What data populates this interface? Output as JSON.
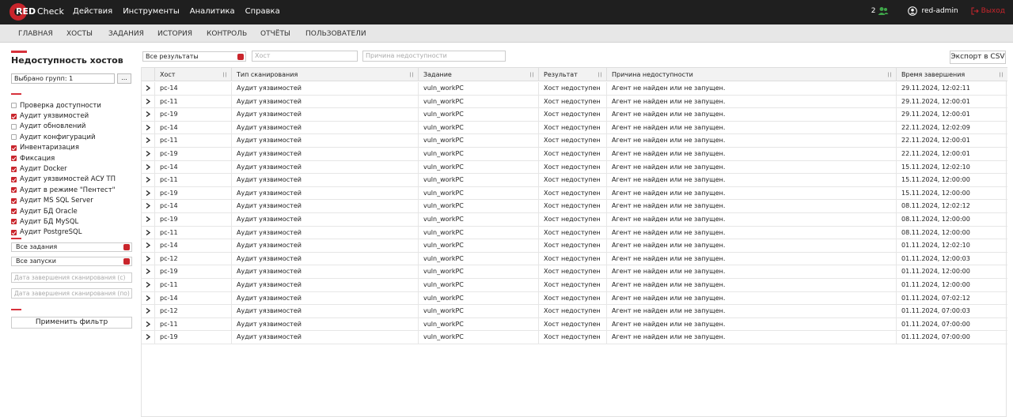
{
  "app": {
    "logo_red": "RED",
    "logo_check": "Check",
    "nav": [
      "Действия",
      "Инструменты",
      "Аналитика",
      "Справка"
    ],
    "notifications_count": "2",
    "user": "red-admin",
    "logout": "Выход"
  },
  "subnav": [
    "ГЛАВНАЯ",
    "ХОСТЫ",
    "ЗАДАНИЯ",
    "ИСТОРИЯ",
    "КОНТРОЛЬ",
    "ОТЧЁТЫ",
    "ПОЛЬЗОВАТЕЛИ"
  ],
  "sidebar": {
    "title": "Недоступность хостов",
    "group_select": "Выбрано групп: 1",
    "group_more": "...",
    "checkboxes": [
      {
        "label": "Проверка доступности",
        "checked": false
      },
      {
        "label": "Аудит уязвимостей",
        "checked": true
      },
      {
        "label": "Аудит обновлений",
        "checked": false
      },
      {
        "label": "Аудит конфигураций",
        "checked": false
      },
      {
        "label": "Инвентаризация",
        "checked": true
      },
      {
        "label": "Фиксация",
        "checked": true
      },
      {
        "label": "Аудит Docker",
        "checked": true
      },
      {
        "label": "Аудит уязвимостей АСУ ТП",
        "checked": true
      },
      {
        "label": "Аудит в режиме \"Пентест\"",
        "checked": true
      },
      {
        "label": "Аудит MS SQL Server",
        "checked": true
      },
      {
        "label": "Аудит БД Oracle",
        "checked": true
      },
      {
        "label": "Аудит БД MySQL",
        "checked": true
      },
      {
        "label": "Аудит PostgreSQL",
        "checked": true
      }
    ],
    "tasks_select": "Все задания",
    "runs_select": "Все запуски",
    "date_from_placeholder": "Дата завершения сканирования (с)",
    "date_to_placeholder": "Дата завершения сканирования (по)",
    "apply_button": "Применить фильтр"
  },
  "filters": {
    "result_select": "Все результаты",
    "host_placeholder": "Хост",
    "reason_placeholder": "Причина недоступности",
    "export_button": "Экспорт в CSV"
  },
  "table": {
    "columns": [
      "Хост",
      "Тип сканирования",
      "Задание",
      "Результат",
      "Причина недоступности",
      "Время завершения"
    ],
    "rows": [
      [
        "pc-14",
        "Аудит уязвимостей",
        "vuln_workPC",
        "Хост недоступен",
        "Агент не найден или не запущен.",
        "29.11.2024, 12:02:11"
      ],
      [
        "pc-11",
        "Аудит уязвимостей",
        "vuln_workPC",
        "Хост недоступен",
        "Агент не найден или не запущен.",
        "29.11.2024, 12:00:01"
      ],
      [
        "pc-19",
        "Аудит уязвимостей",
        "vuln_workPC",
        "Хост недоступен",
        "Агент не найден или не запущен.",
        "29.11.2024, 12:00:01"
      ],
      [
        "pc-14",
        "Аудит уязвимостей",
        "vuln_workPC",
        "Хост недоступен",
        "Агент не найден или не запущен.",
        "22.11.2024, 12:02:09"
      ],
      [
        "pc-11",
        "Аудит уязвимостей",
        "vuln_workPC",
        "Хост недоступен",
        "Агент не найден или не запущен.",
        "22.11.2024, 12:00:01"
      ],
      [
        "pc-19",
        "Аудит уязвимостей",
        "vuln_workPC",
        "Хост недоступен",
        "Агент не найден или не запущен.",
        "22.11.2024, 12:00:01"
      ],
      [
        "pc-14",
        "Аудит уязвимостей",
        "vuln_workPC",
        "Хост недоступен",
        "Агент не найден или не запущен.",
        "15.11.2024, 12:02:10"
      ],
      [
        "pc-11",
        "Аудит уязвимостей",
        "vuln_workPC",
        "Хост недоступен",
        "Агент не найден или не запущен.",
        "15.11.2024, 12:00:00"
      ],
      [
        "pc-19",
        "Аудит уязвимостей",
        "vuln_workPC",
        "Хост недоступен",
        "Агент не найден или не запущен.",
        "15.11.2024, 12:00:00"
      ],
      [
        "pc-14",
        "Аудит уязвимостей",
        "vuln_workPC",
        "Хост недоступен",
        "Агент не найден или не запущен.",
        "08.11.2024, 12:02:12"
      ],
      [
        "pc-19",
        "Аудит уязвимостей",
        "vuln_workPC",
        "Хост недоступен",
        "Агент не найден или не запущен.",
        "08.11.2024, 12:00:00"
      ],
      [
        "pc-11",
        "Аудит уязвимостей",
        "vuln_workPC",
        "Хост недоступен",
        "Агент не найден или не запущен.",
        "08.11.2024, 12:00:00"
      ],
      [
        "pc-14",
        "Аудит уязвимостей",
        "vuln_workPC",
        "Хост недоступен",
        "Агент не найден или не запущен.",
        "01.11.2024, 12:02:10"
      ],
      [
        "pc-12",
        "Аудит уязвимостей",
        "vuln_workPC",
        "Хост недоступен",
        "Агент не найден или не запущен.",
        "01.11.2024, 12:00:03"
      ],
      [
        "pc-19",
        "Аудит уязвимостей",
        "vuln_workPC",
        "Хост недоступен",
        "Агент не найден или не запущен.",
        "01.11.2024, 12:00:00"
      ],
      [
        "pc-11",
        "Аудит уязвимостей",
        "vuln_workPC",
        "Хост недоступен",
        "Агент не найден или не запущен.",
        "01.11.2024, 12:00:00"
      ],
      [
        "pc-14",
        "Аудит уязвимостей",
        "vuln_workPC",
        "Хост недоступен",
        "Агент не найден или не запущен.",
        "01.11.2024, 07:02:12"
      ],
      [
        "pc-12",
        "Аудит уязвимостей",
        "vuln_workPC",
        "Хост недоступен",
        "Агент не найден или не запущен.",
        "01.11.2024, 07:00:03"
      ],
      [
        "pc-11",
        "Аудит уязвимостей",
        "vuln_workPC",
        "Хост недоступен",
        "Агент не найден или не запущен.",
        "01.11.2024, 07:00:00"
      ],
      [
        "pc-19",
        "Аудит уязвимостей",
        "vuln_workPC",
        "Хост недоступен",
        "Агент не найден или не запущен.",
        "01.11.2024, 07:00:00"
      ]
    ]
  },
  "colors": {
    "accent": "#c9252c",
    "topbar": "#1f1f1f",
    "online_green": "#3fa64a"
  }
}
